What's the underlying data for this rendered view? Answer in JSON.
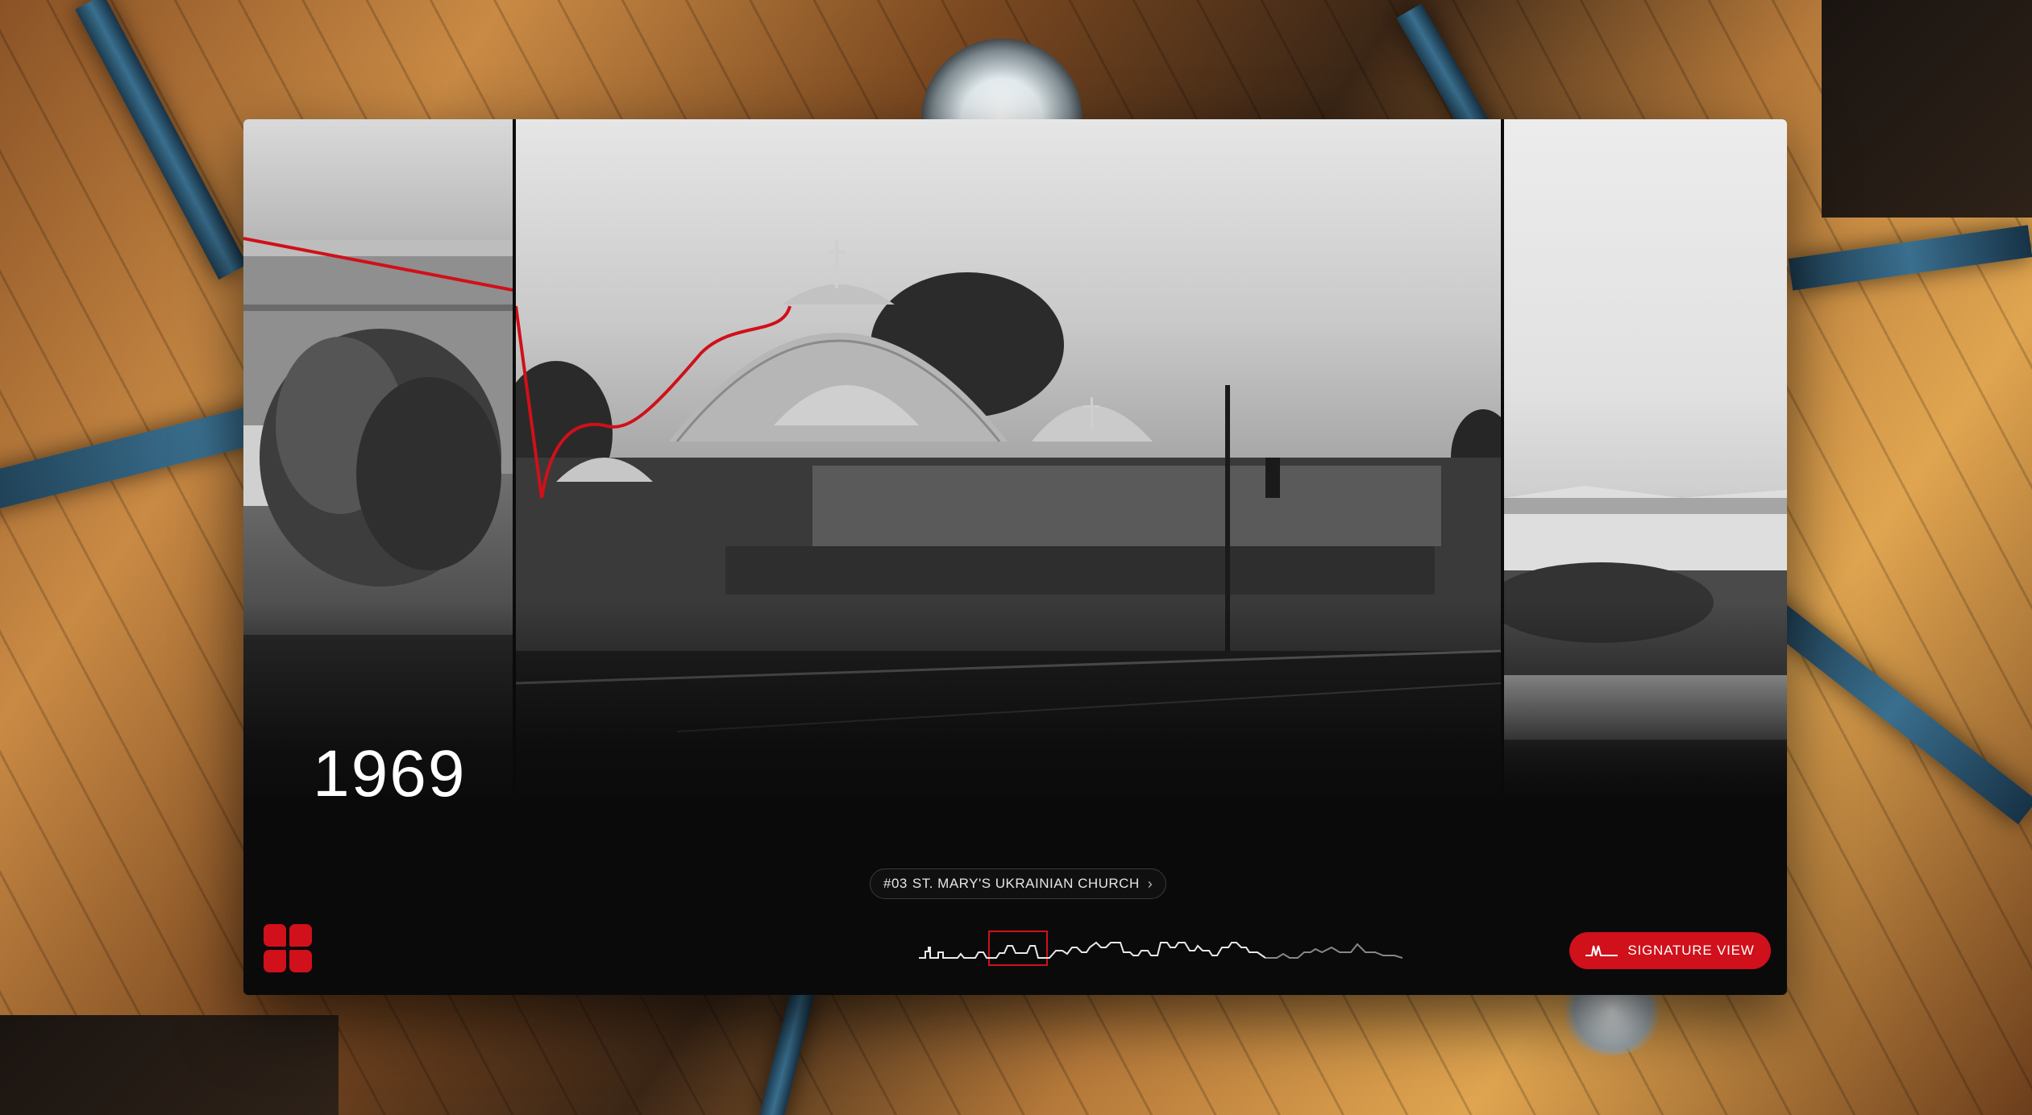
{
  "year": "1969",
  "church": {
    "number": "#03",
    "name": "ST. MARY'S UKRAINIAN CHURCH",
    "chevron": "›"
  },
  "signature_button": {
    "label": "SIGNATURE VIEW",
    "icon": "signature-line-icon"
  },
  "colors": {
    "accent": "#d0101a",
    "card_background": "#0a0a0b",
    "text": "#ffffff"
  },
  "icons": [
    "grid-logo-icon",
    "chevron-right-icon",
    "signature-line-icon",
    "skyline-timeline"
  ]
}
